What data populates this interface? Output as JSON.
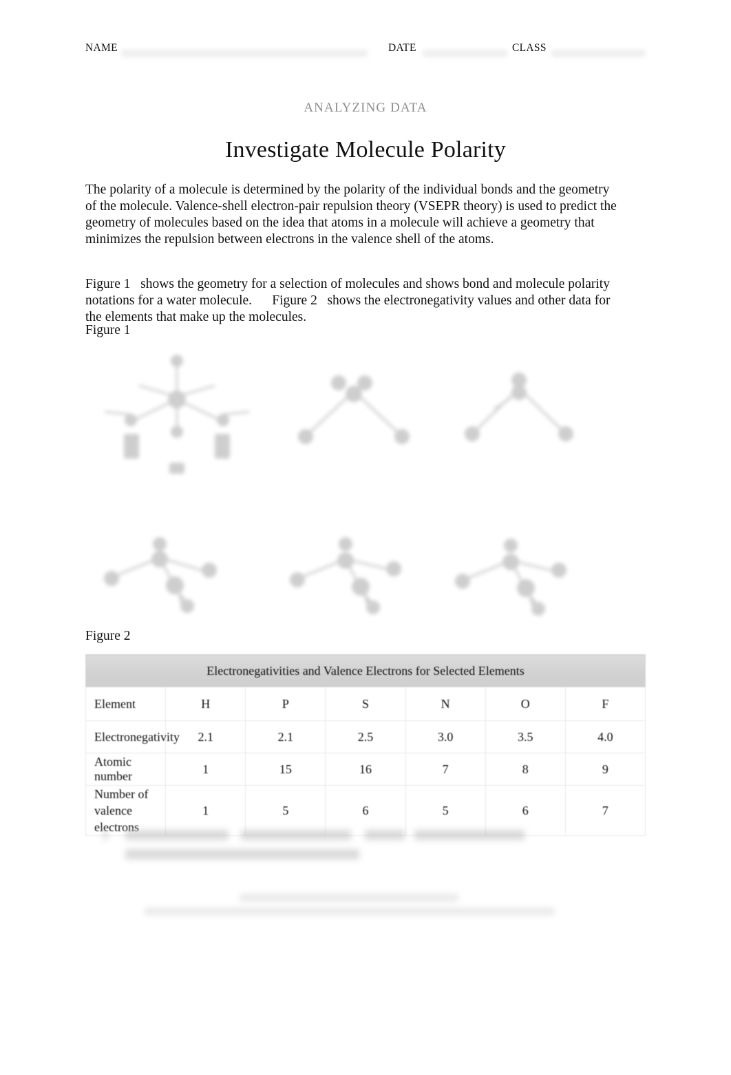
{
  "header": {
    "name_label": "NAME",
    "date_label": "DATE",
    "class_label": "CLASS"
  },
  "title": {
    "kicker": "ANALYZING DATA",
    "heading": "Investigate Molecule Polarity"
  },
  "body": {
    "paragraph_1": "The polarity of a molecule is determined by the polarity of the individual bonds and the geometry of the molecule. Valence-shell electron-pair repulsion theory (VSEPR theory) is used to predict the geometry of molecules based on the idea that atoms in a molecule will achieve a geometry that minimizes the repulsion between electrons in the valence shell of the atoms.",
    "paragraph_2_a": "Figure 1",
    "paragraph_2_b": "shows the geometry for a selection of molecules and shows bond and molecule polarity notations for a water molecule.",
    "paragraph_2_c": "Figure 2",
    "paragraph_2_d": "shows the electronegativity values and other data for the elements that make up the molecules."
  },
  "figure1": {
    "caption": "Figure 1",
    "molecules": [
      {
        "name": "water-polarity-notation-diagram",
        "geometry": "bent"
      },
      {
        "name": "bent-molecule-diagram-2",
        "geometry": "bent"
      },
      {
        "name": "bent-molecule-diagram-3",
        "geometry": "bent"
      },
      {
        "name": "trigonal-pyramidal-diagram-1",
        "geometry": "trigonal-pyramidal"
      },
      {
        "name": "trigonal-pyramidal-diagram-2",
        "geometry": "trigonal-pyramidal"
      },
      {
        "name": "trigonal-pyramidal-diagram-3",
        "geometry": "trigonal-pyramidal"
      }
    ]
  },
  "figure2": {
    "caption": "Figure 2",
    "table": {
      "title": "Electronegativities and Valence Electrons for Selected Elements",
      "row_headers": [
        "Element",
        "Electronegativity",
        "Atomic number",
        "Number of valence electrons"
      ],
      "elements": [
        "H",
        "P",
        "S",
        "N",
        "O",
        "F"
      ],
      "electronegativity": [
        "2.1",
        "2.1",
        "2.5",
        "3.0",
        "3.5",
        "4.0"
      ],
      "atomic_number": [
        "1",
        "15",
        "16",
        "7",
        "8",
        "9"
      ],
      "valence_electrons": [
        "1",
        "5",
        "6",
        "5",
        "6",
        "7"
      ]
    }
  },
  "colors": {
    "page_background": "#ffffff",
    "text": "#111111",
    "kicker_gray": "#8e8e8e",
    "table_header_band": "#d2d2d2",
    "table_border": "#e9e9e9",
    "rule_gray": "#efefef"
  }
}
